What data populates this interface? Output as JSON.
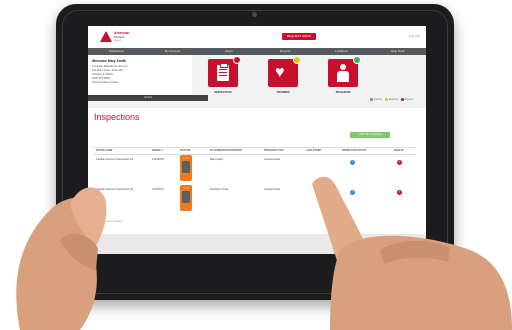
{
  "header": {
    "logo_line1": "American",
    "logo_line2": "Medical",
    "logo_line3": "Assoc.",
    "top_button": "REQUEST DEMO",
    "logout": "Log Out"
  },
  "nav": {
    "items": [
      "Dashboard",
      "My Account",
      "Users",
      "Reports",
      "Locations",
      "Help Desk"
    ]
  },
  "profile": {
    "welcome": "Welcome Mary Smith",
    "lines": [
      "Complete Medical Services Inc",
      "123 Main Street, Suite 200",
      "Chicago, IL 60601",
      "(555) 555-5555",
      "Account Status: Active"
    ],
    "bar_label": "Update"
  },
  "cards": [
    {
      "label": "INSPECTION",
      "badge_color": "#c8102e"
    },
    {
      "label": "TRAINING",
      "badge_color": "#f2c200"
    },
    {
      "label": "PROGRAM",
      "badge_color": "#4caf50"
    }
  ],
  "legend": {
    "items": [
      {
        "label": "Current",
        "color": "#4caf50"
      },
      {
        "label": "Expiring",
        "color": "#f2c200"
      },
      {
        "label": "Expired",
        "color": "#c8102e"
      }
    ]
  },
  "content": {
    "title": "Inspections",
    "add_button": "+ Add New Inspection",
    "columns": [
      "DEVICE NAME",
      "SERIAL #",
      "PICTURE",
      "PLACEMENT DESCRIPTION",
      "PROGRAM TYPE",
      "LAST EXPIRY",
      "INSPECTION STATUS",
      "DELETE"
    ],
    "rows": [
      {
        "device": "Cardiac Science Powerheart G3",
        "serial": "12345678",
        "placement": "Main Lobby",
        "program": "Unsupervised"
      },
      {
        "device": "Cardiac Science Powerheart G3",
        "serial": "12345679",
        "placement": "Reception Desk",
        "program": "Unsupervised"
      }
    ],
    "pager": "Showing 1 to 2 of 2 entries"
  },
  "colors": {
    "brand": "#c8102e",
    "nav": "#555a5f",
    "success": "#7fc96a",
    "info": "#2d8ccc",
    "device": "#f07b1e"
  }
}
